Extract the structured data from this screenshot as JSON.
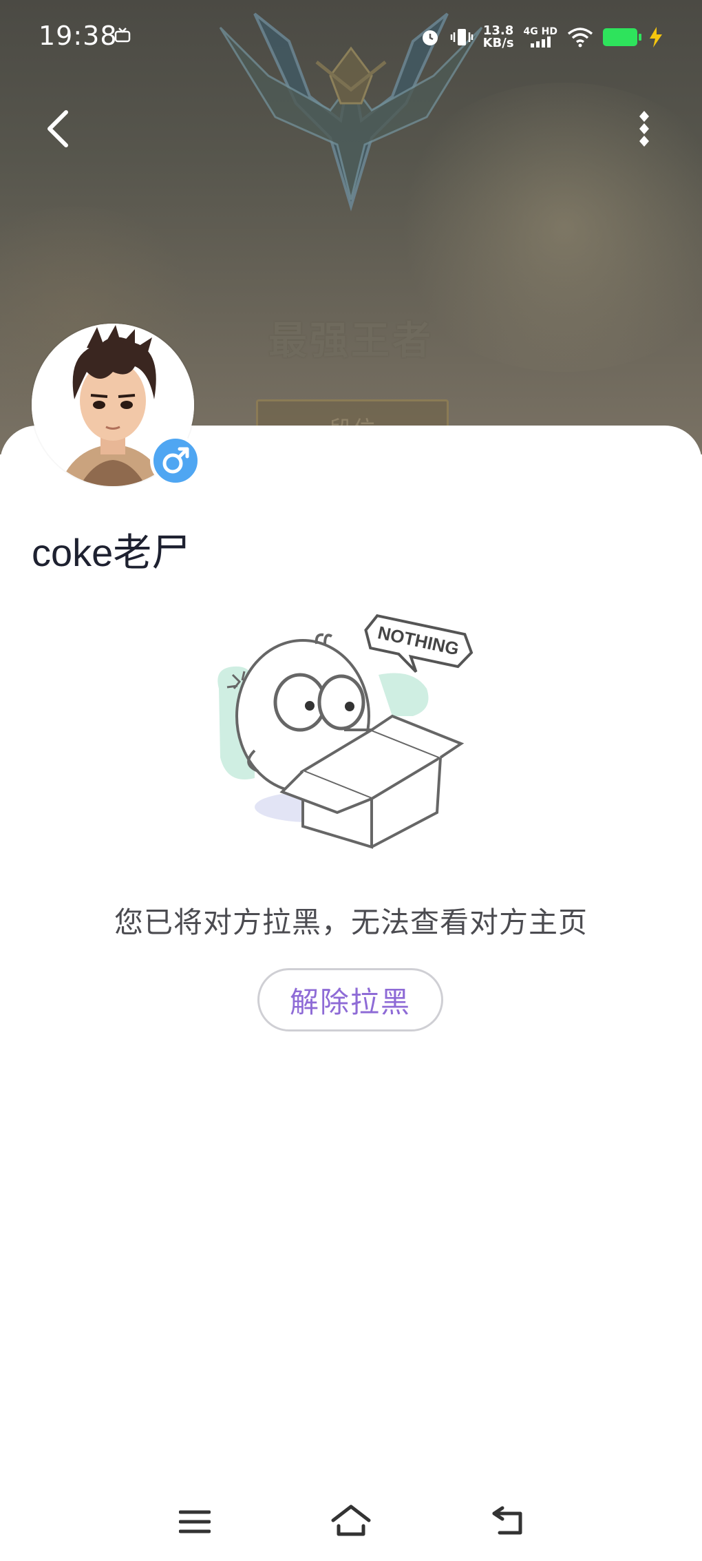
{
  "status_bar": {
    "time": "19:38",
    "net_speed_value": "13.8",
    "net_speed_unit": "KB/s",
    "network_type": "4G HD",
    "battery_color": "#2ee35c"
  },
  "banner": {
    "rank_title": "最强王者",
    "plate_text": "段位"
  },
  "profile": {
    "username": "coke老尸",
    "gender_icon": "male-icon",
    "gender_badge_color": "#4fa6f2"
  },
  "empty_state": {
    "illustration_text": "NOTHING",
    "message": "您已将对方拉黑，无法查看对方主页",
    "unblock_label": "解除拉黑",
    "accent_color": "#8e6bd6"
  },
  "icons": {
    "back": "back-arrow-icon",
    "more": "more-vertical-icon",
    "nav_menu": "menu-icon",
    "nav_home": "home-icon",
    "nav_back": "return-icon"
  }
}
